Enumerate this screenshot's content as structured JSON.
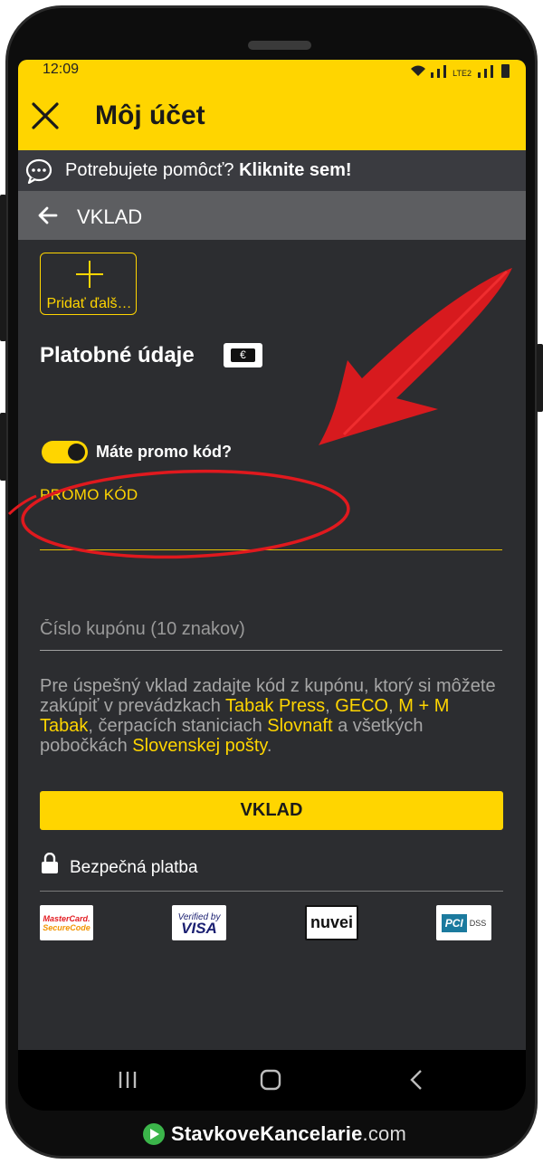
{
  "status_bar": {
    "time": "12:09",
    "network": "LTE2"
  },
  "header": {
    "title": "Môj účet",
    "close_icon": "close-icon"
  },
  "help_bar": {
    "prefix": "Potrebujete pomôcť?",
    "link": "Kliknite sem!",
    "icon": "chat-bubble-icon"
  },
  "section": {
    "title": "VKLAD",
    "back_icon": "arrow-left-icon"
  },
  "add_method": {
    "label": "Pridať ďalš…",
    "icon": "plus-icon"
  },
  "payment": {
    "title": "Platobné údaje",
    "method_icon": "euro-card-icon"
  },
  "promo": {
    "toggle_on": true,
    "question": "Máte promo kód?",
    "label": "PROMO KÓD",
    "value": ""
  },
  "coupon": {
    "placeholder": "Číslo kupónu (10 znakov)",
    "value": ""
  },
  "info": {
    "p1": "Pre úspešný vklad zadajte kód z kupónu, ktorý si môžete zakúpiť v prevádzkach ",
    "h1": "Tabak Press",
    "p2": ", ",
    "h2": "GECO",
    "p3": ", ",
    "h3": "M + M Tabak",
    "p4": ", čerpacích staniciach ",
    "h4": "Slovnaft",
    "p5": " a všetkých pobočkách ",
    "h5": "Slovenskej pošty",
    "p6": "."
  },
  "deposit_button": "VKLAD",
  "security": {
    "label": "Bezpečná platba",
    "icon": "lock-icon"
  },
  "badges": {
    "mastercard_line1": "MasterCard.",
    "mastercard_line2": "SecureCode",
    "visa_line1": "Verified by",
    "visa_line2": "VISA",
    "nuvei": "nuvei",
    "pci": "PCI",
    "dss": "DSS"
  },
  "nav": {
    "recents_icon": "recents-icon",
    "home_icon": "home-icon",
    "back_icon": "nav-back-icon"
  },
  "watermark": {
    "name": "StavkoveKancelarie",
    "domain": ".com"
  },
  "colors": {
    "brand_yellow": "#ffd500",
    "background": "#2c2d30",
    "annotation_red": "#e0191e"
  }
}
